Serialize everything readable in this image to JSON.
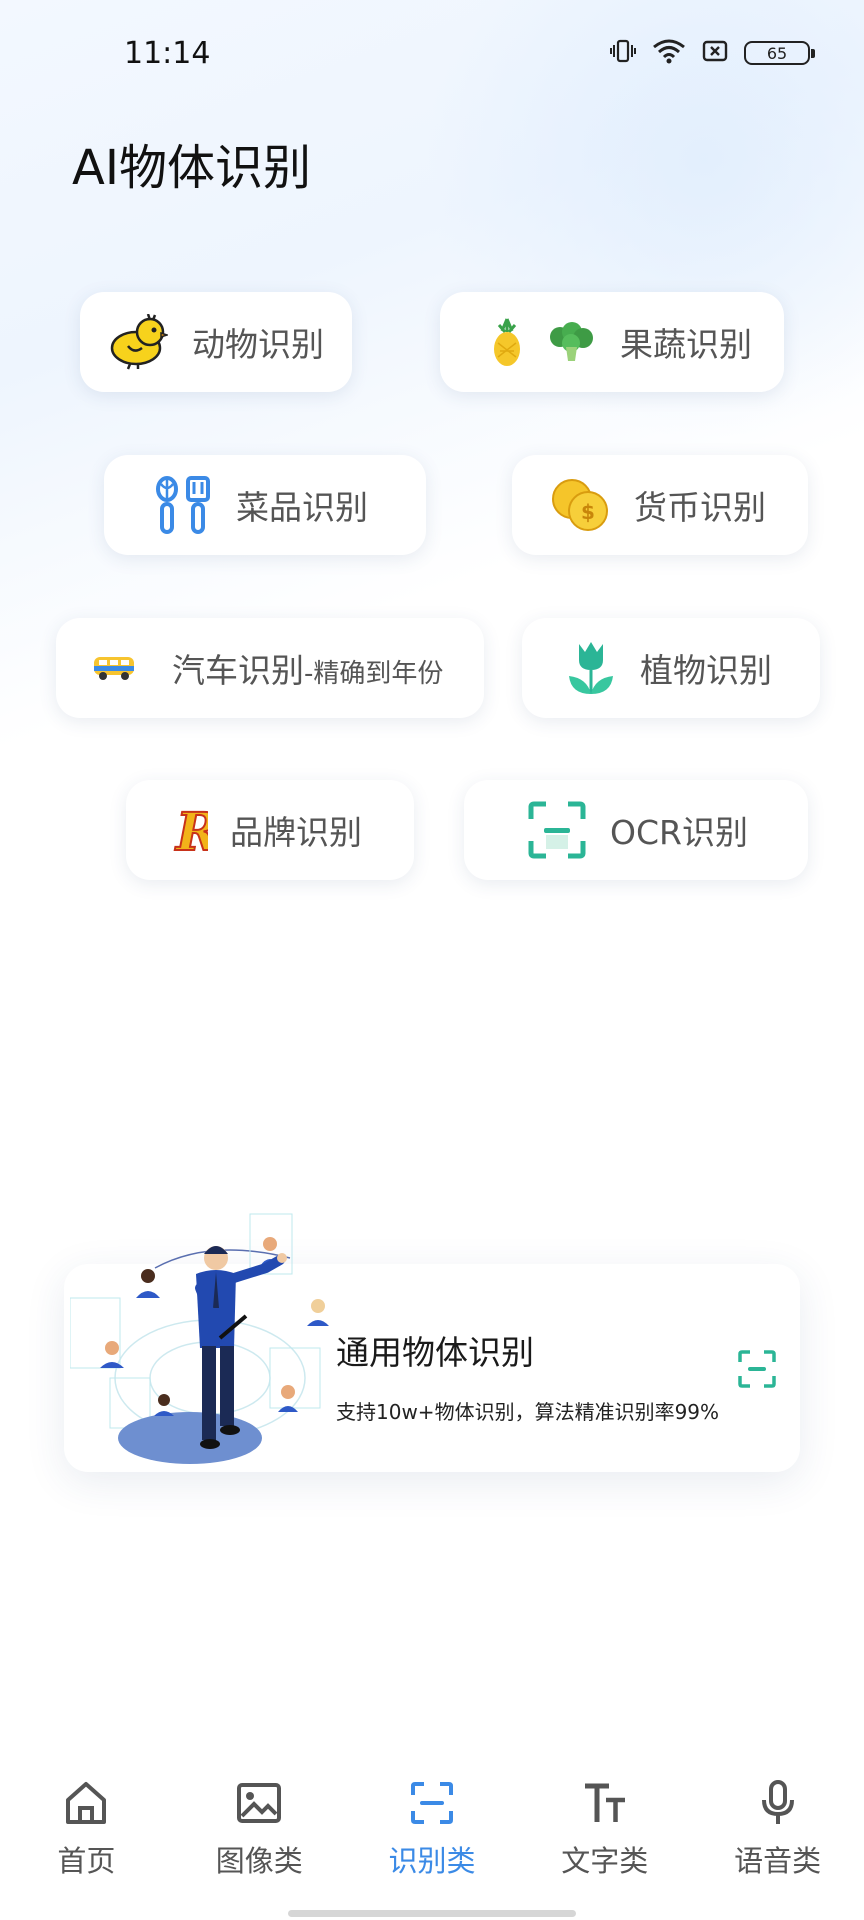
{
  "status_bar": {
    "time": "11:14",
    "battery": "65"
  },
  "page_title": "AI物体识别",
  "chips": {
    "animal": "动物识别",
    "fruit_veg": "果蔬识别",
    "dish": "菜品识别",
    "currency": "货币识别",
    "car": "汽车识别",
    "car_suffix": "-精确到年份",
    "plant": "植物识别",
    "brand": "品牌识别",
    "ocr": "OCR识别"
  },
  "feature_card": {
    "title": "通用物体识别",
    "description": "支持10w+物体识别，算法精准识别率99%"
  },
  "nav": {
    "items": [
      {
        "label": "首页",
        "icon": "home-icon"
      },
      {
        "label": "图像类",
        "icon": "image-icon"
      },
      {
        "label": "识别类",
        "icon": "scan-icon"
      },
      {
        "label": "文字类",
        "icon": "text-icon"
      },
      {
        "label": "语音类",
        "icon": "mic-icon"
      }
    ],
    "active_index": 2
  },
  "colors": {
    "accent": "#3b8ae6",
    "teal": "#2bb596",
    "chick": "#f7d21c"
  }
}
